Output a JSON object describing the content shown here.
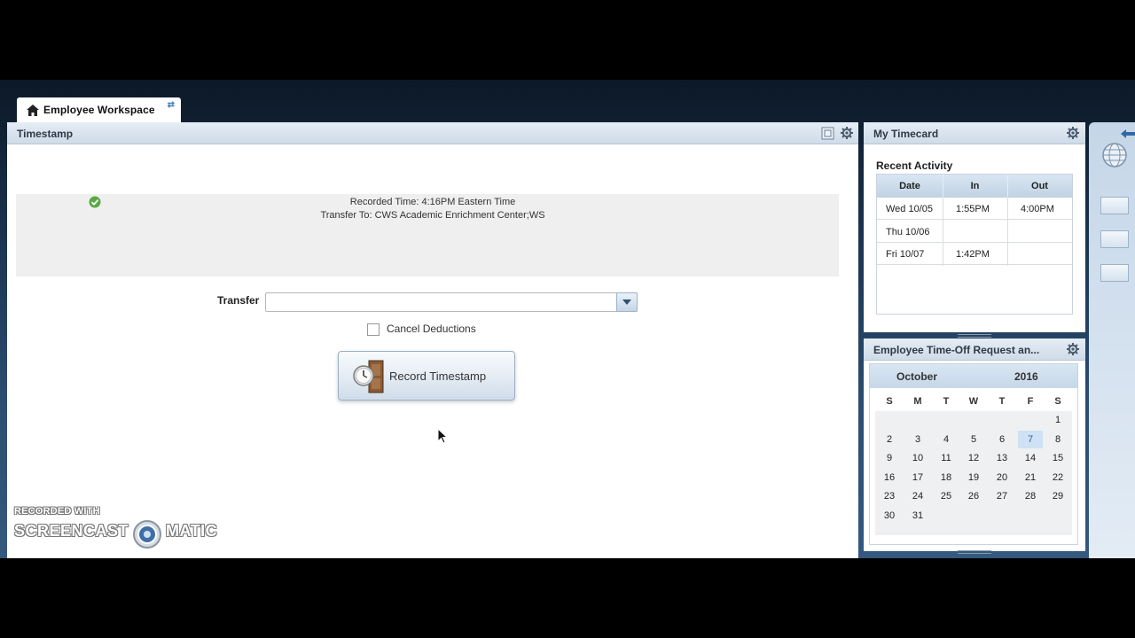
{
  "tab": {
    "label": "Employee Workspace"
  },
  "timestamp_panel": {
    "title": "Timestamp",
    "recorded_line": "Recorded Time: 4:16PM  Eastern Time",
    "transfer_line": "Transfer To: CWS Academic Enrichment Center;WS",
    "transfer_label": "Transfer",
    "transfer_value": "",
    "cancel_deductions_label": "Cancel Deductions",
    "cancel_deductions_checked": false,
    "record_button_label": "Record Timestamp"
  },
  "timecard_panel": {
    "title": "My Timecard",
    "subtitle": "Recent Activity",
    "columns": [
      "Date",
      "In",
      "Out"
    ],
    "rows": [
      {
        "date": "Wed 10/05",
        "in": "1:55PM",
        "out": "4:00PM"
      },
      {
        "date": "Thu 10/06",
        "in": "",
        "out": ""
      },
      {
        "date": "Fri 10/07",
        "in": "1:42PM",
        "out": ""
      }
    ]
  },
  "timeoff_panel": {
    "title": "Employee Time-Off Request an...",
    "calendar": {
      "month": "October",
      "year": "2016",
      "weekdays": [
        "S",
        "M",
        "T",
        "W",
        "T",
        "F",
        "S"
      ],
      "weeks": [
        [
          "",
          "",
          "",
          "",
          "",
          "",
          "1"
        ],
        [
          "2",
          "3",
          "4",
          "5",
          "6",
          "7",
          "8"
        ],
        [
          "9",
          "10",
          "11",
          "12",
          "13",
          "14",
          "15"
        ],
        [
          "16",
          "17",
          "18",
          "19",
          "20",
          "21",
          "22"
        ],
        [
          "23",
          "24",
          "25",
          "26",
          "27",
          "28",
          "29"
        ],
        [
          "30",
          "31",
          "",
          "",
          "",
          "",
          ""
        ]
      ],
      "highlighted_day": "7"
    }
  },
  "watermark": {
    "line1": "RECORDED WITH",
    "word1": "SCREENCAST",
    "word2": "MATIC"
  },
  "colors": {
    "accent": "#2467a8",
    "panel_header": "#cfdbe8",
    "today": "#cfe2f5"
  }
}
